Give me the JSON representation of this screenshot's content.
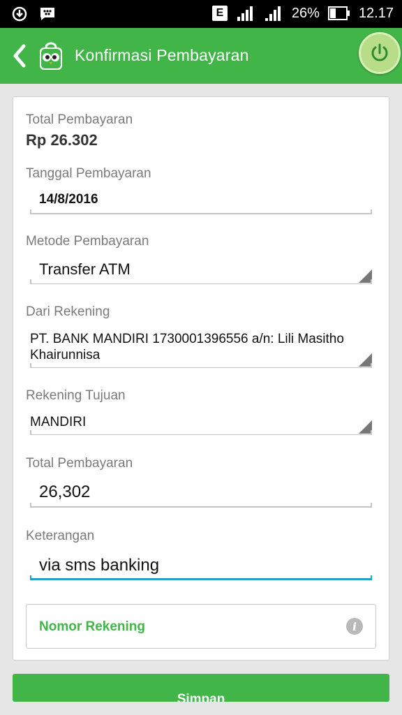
{
  "status_bar": {
    "network_badge": "E",
    "battery": "26%",
    "time": "12.17"
  },
  "app_bar": {
    "title": "Konfirmasi Pembayaran",
    "back_icon": "chevron-left-icon",
    "logo_icon": "owl-shopping-bag-icon",
    "power_icon": "power-icon"
  },
  "form": {
    "total_label": "Total Pembayaran",
    "total_value": "Rp 26.302",
    "date_label": "Tanggal Pembayaran",
    "date_value": "14/8/2016",
    "method_label": "Metode Pembayaran",
    "method_value": "Transfer ATM",
    "from_account_label": "Dari Rekening",
    "from_account_value": "PT. BANK MANDIRI 1730001396556 a/n: Lili Masitho Khairunnisa",
    "dest_account_label": "Rekening Tujuan",
    "dest_account_value": "MANDIRI",
    "amount_label": "Total Pembayaran",
    "amount_value": "26,302",
    "note_label": "Keterangan",
    "note_value": "via sms banking",
    "account_number_label": "Nomor Rekening"
  },
  "actions": {
    "save_label": "Simpan"
  },
  "colors": {
    "brand_green": "#42b549",
    "focus_blue": "#1fa3c9"
  }
}
